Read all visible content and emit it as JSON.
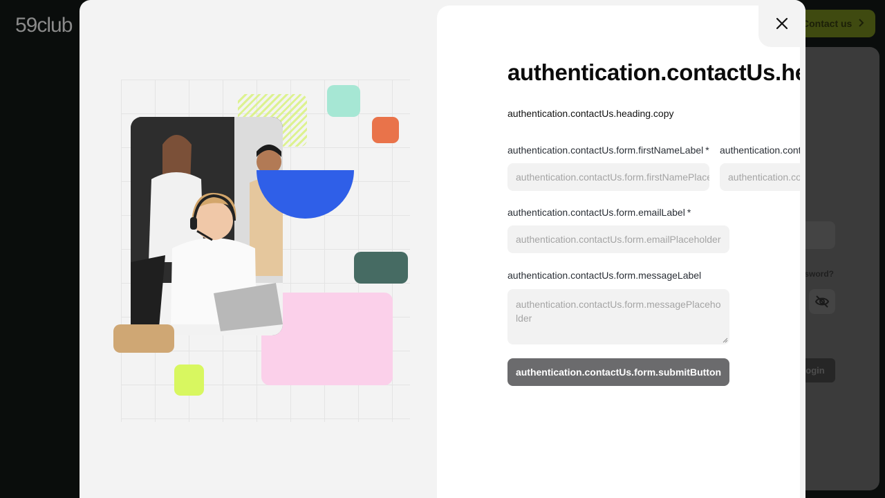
{
  "background": {
    "logo": "59club",
    "contact_button_label": "Contact us",
    "forgot_password": "assword?",
    "login_button": "ogin"
  },
  "modal": {
    "close_icon": "close-icon",
    "heading": "authentication.contactUs.heading",
    "copy": "authentication.contactUs.heading.copy",
    "form": {
      "first_name_label": "authentication.contactUs.form.firstNameLabel",
      "first_name_placeholder": "authentication.contactUs.form.firstNamePlaceholder",
      "last_name_label": "authentication.contactUs.form.lastNameLabel",
      "last_name_placeholder": "authentication.contactUs.form.lastNamePlaceholder",
      "email_label": "authentication.contactUs.form.emailLabel",
      "email_placeholder": "authentication.contactUs.form.emailPlaceholder",
      "message_label": "authentication.contactUs.form.messageLabel",
      "message_placeholder": "authentication.contactUs.form.messagePlaceholder",
      "submit_button": "authentication.contactUs.form.submitButton",
      "required_marker": "*"
    }
  },
  "colors": {
    "accent_blue": "#2f5fe8",
    "mint": "#a6e7d4",
    "orange": "#e9734a",
    "teal_dark": "#466b63",
    "pink": "#fbd0ea",
    "tan": "#cfa774",
    "lime": "#d8f760",
    "submit_bg": "#6b6b6d"
  }
}
